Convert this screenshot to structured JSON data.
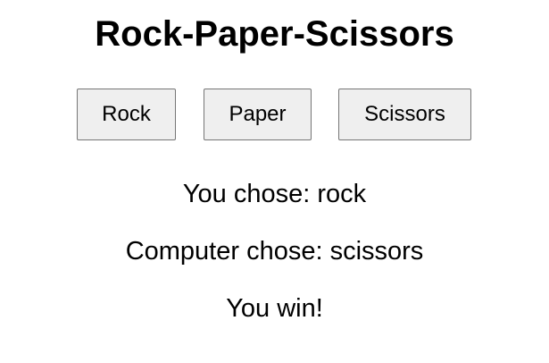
{
  "title": "Rock-Paper-Scissors",
  "buttons": {
    "rock": "Rock",
    "paper": "Paper",
    "scissors": "Scissors"
  },
  "result": {
    "user_choice": "You chose: rock",
    "computer_choice": "Computer chose: scissors",
    "outcome": "You win!"
  },
  "colors": {
    "background": "#ffffff",
    "text": "#000000",
    "button_background": "#efefef",
    "button_border": "#767676"
  }
}
